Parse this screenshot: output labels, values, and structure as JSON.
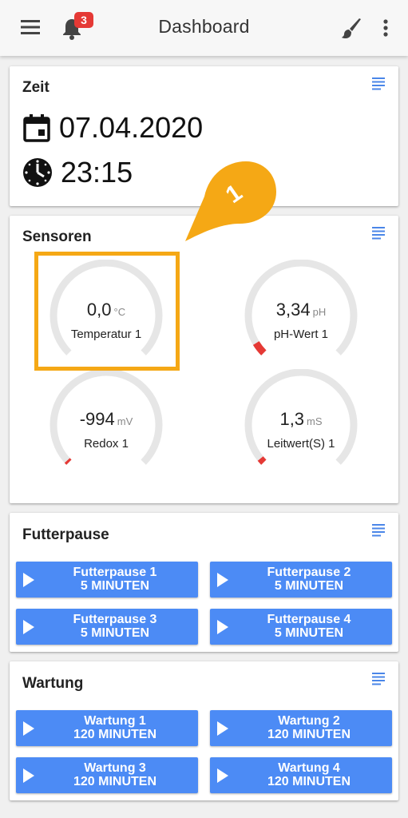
{
  "appbar": {
    "title": "Dashboard",
    "notification_count": "3",
    "icons": [
      "menu-icon",
      "bell-icon",
      "brush-icon",
      "more-vert-icon"
    ]
  },
  "zeit": {
    "title": "Zeit",
    "date": "07.04.2020",
    "time": "23:15"
  },
  "sensoren": {
    "title": "Sensoren",
    "gauges": [
      {
        "value": "0,0",
        "unit": "°C",
        "label": "Temperatur 1",
        "fill_fraction": 0.0
      },
      {
        "value": "3,34",
        "unit": "pH",
        "label": "pH-Wert 1",
        "fill_fraction": 0.05
      },
      {
        "value": "-994",
        "unit": "mV",
        "label": "Redox 1",
        "fill_fraction": 0.01
      },
      {
        "value": "1,3",
        "unit": "mS",
        "label": "Leitwert(S) 1",
        "fill_fraction": 0.02
      }
    ]
  },
  "futterpause": {
    "title": "Futterpause",
    "buttons": [
      {
        "line1": "Futterpause 1",
        "line2": "5 MINUTEN"
      },
      {
        "line1": "Futterpause 2",
        "line2": "5 MINUTEN"
      },
      {
        "line1": "Futterpause 3",
        "line2": "5 MINUTEN"
      },
      {
        "line1": "Futterpause 4",
        "line2": "5 MINUTEN"
      }
    ]
  },
  "wartung": {
    "title": "Wartung",
    "buttons": [
      {
        "line1": "Wartung 1",
        "line2": "120 MINUTEN"
      },
      {
        "line1": "Wartung 2",
        "line2": "120 MINUTEN"
      },
      {
        "line1": "Wartung 3",
        "line2": "120 MINUTEN"
      },
      {
        "line1": "Wartung 4",
        "line2": "120 MINUTEN"
      }
    ]
  },
  "annotation": {
    "marker_label": "1"
  },
  "colors": {
    "button_blue": "#4c8bf5",
    "menu_blue": "#4a86e8",
    "highlight_orange": "#f5a815",
    "gauge_track": "#e6e6e6",
    "gauge_red": "#e53935",
    "badge_red": "#e53935"
  }
}
